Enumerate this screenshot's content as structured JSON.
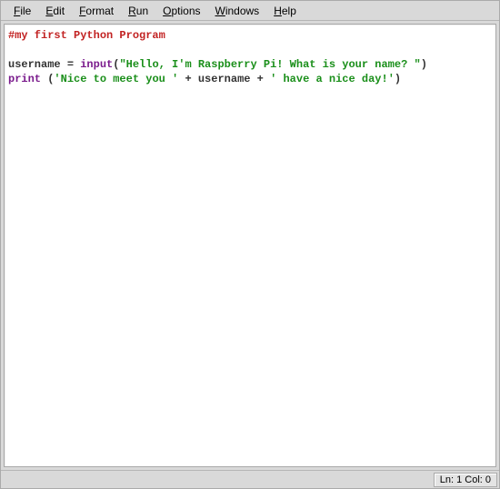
{
  "menubar": {
    "items": [
      {
        "accel": "F",
        "rest": "ile"
      },
      {
        "accel": "E",
        "rest": "dit"
      },
      {
        "accel": "F",
        "rest": "ormat"
      },
      {
        "accel": "R",
        "rest": "un"
      },
      {
        "accel": "O",
        "rest": "ptions"
      },
      {
        "accel": "W",
        "rest": "indows"
      },
      {
        "accel": "H",
        "rest": "elp"
      }
    ]
  },
  "code": {
    "line1_comment": "#my first Python Program",
    "line3_ident": "username ",
    "line3_op": "= ",
    "line3_builtin": "input",
    "line3_paren_open": "(",
    "line3_string": "\"Hello, I'm Raspberry Pi! What is your name? \"",
    "line3_paren_close": ")",
    "line4_builtin": "print ",
    "line4_paren_open": "(",
    "line4_string1": "'Nice to meet you '",
    "line4_op1": " + ",
    "line4_ident": "username",
    "line4_op2": " + ",
    "line4_string2": "' have a nice day!'",
    "line4_paren_close": ")"
  },
  "status": {
    "position": "Ln: 1 Col: 0"
  }
}
